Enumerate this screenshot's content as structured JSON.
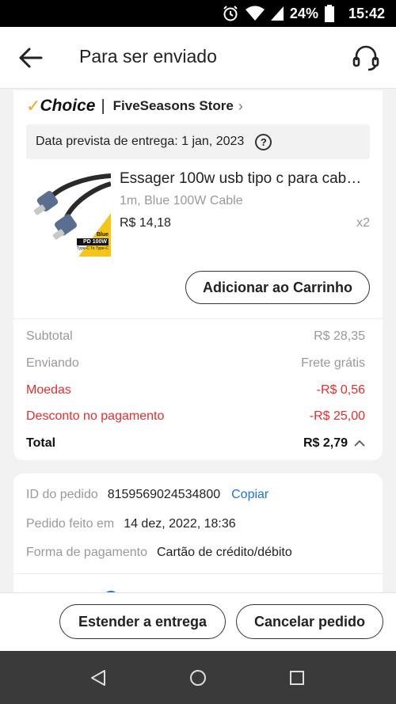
{
  "status_bar": {
    "battery": "24%",
    "time": "15:42"
  },
  "header": {
    "title": "Para ser enviado"
  },
  "order": {
    "choice_label": "Choice",
    "store_separator": "|",
    "store_name": "FiveSeasons Store",
    "delivery_text": "Data prevista de entrega: 1 jan, 2023",
    "help_symbol": "?",
    "product": {
      "title": "Essager 100w usb tipo c para cab…",
      "variant": "1m, Blue 100W Cable",
      "price": "R$ 14,18",
      "quantity": "x2",
      "image_badge": {
        "color_name": "Blue",
        "spec": "PD 100W",
        "subtitle": "Type-C To Type-C"
      }
    },
    "add_to_cart_label": "Adicionar ao Carrinho",
    "summary": [
      {
        "label": "Subtotal",
        "value": "R$ 28,35"
      },
      {
        "label": "Enviando",
        "value": "Frete grátis"
      },
      {
        "label": "Moedas",
        "value": "-R$ 0,56"
      },
      {
        "label": "Desconto no pagamento",
        "value": "-R$ 25,00"
      }
    ],
    "total": {
      "label": "Total",
      "value": "R$ 2,79"
    }
  },
  "details": {
    "order_id_label": "ID do pedido",
    "order_id": "8159569024534800",
    "copy_label": "Copiar",
    "placed_label": "Pedido feito em",
    "placed_value": "14 dez, 2022, 18:36",
    "payment_label": "Forma de pagamento",
    "payment_value": "Cartão de crédito/débito"
  },
  "actions": {
    "extend_label": "Estender a entrega",
    "cancel_label": "Cancelar pedido"
  },
  "colors": {
    "discount": "#e62e2e",
    "link": "#1a73e8",
    "choice_check": "#f5a623",
    "nav_bar": "#3a3a3a"
  }
}
